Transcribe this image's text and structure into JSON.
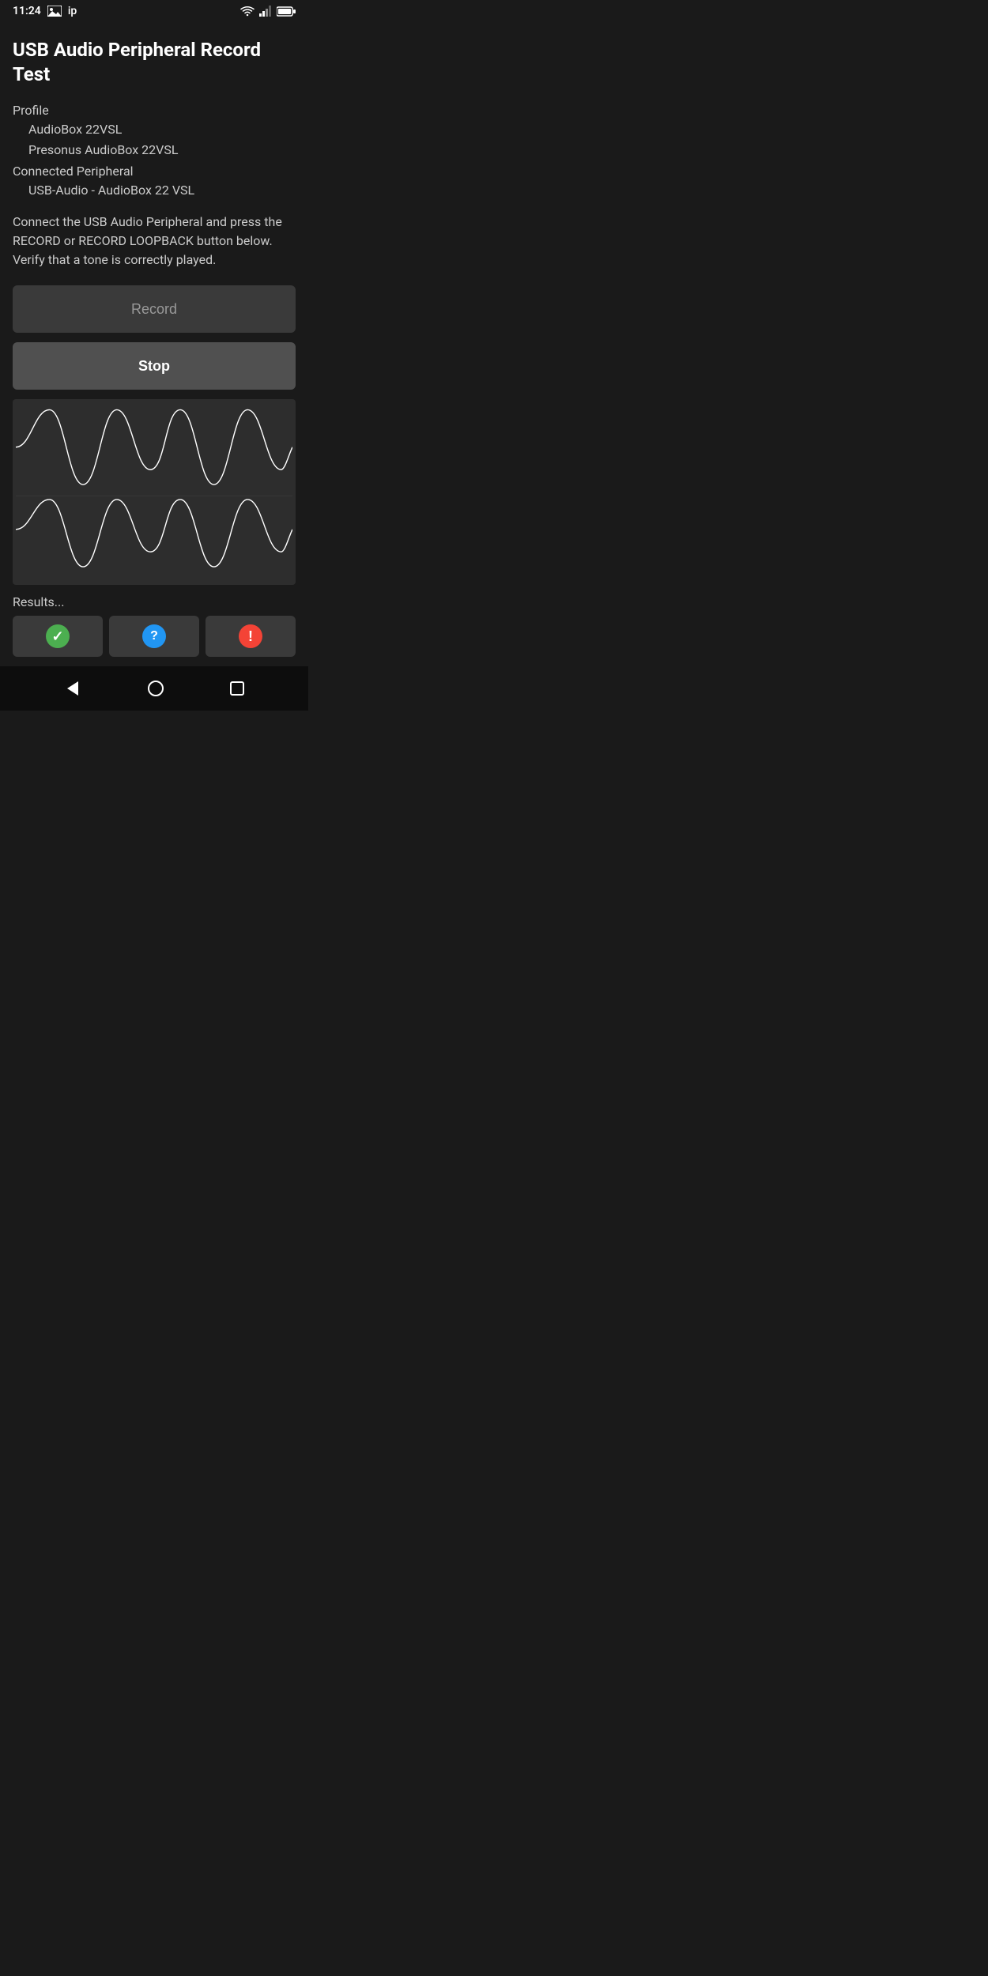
{
  "status_bar": {
    "time": "11:24",
    "icons": [
      "image",
      "ip"
    ]
  },
  "page": {
    "title": "USB Audio Peripheral Record Test",
    "profile_label": "Profile",
    "profile_name": "AudioBox 22VSL",
    "profile_sub": "Presonus AudioBox 22VSL",
    "connected_label": "Connected Peripheral",
    "connected_value": "USB-Audio - AudioBox 22 VSL",
    "instruction": "Connect the USB Audio Peripheral and press the RECORD or RECORD LOOPBACK button below. Verify that a tone is correctly played.",
    "record_button": "Record",
    "stop_button": "Stop",
    "results_label": "Results..."
  },
  "results": {
    "pass_icon": "✓",
    "help_icon": "?",
    "error_icon": "!"
  }
}
